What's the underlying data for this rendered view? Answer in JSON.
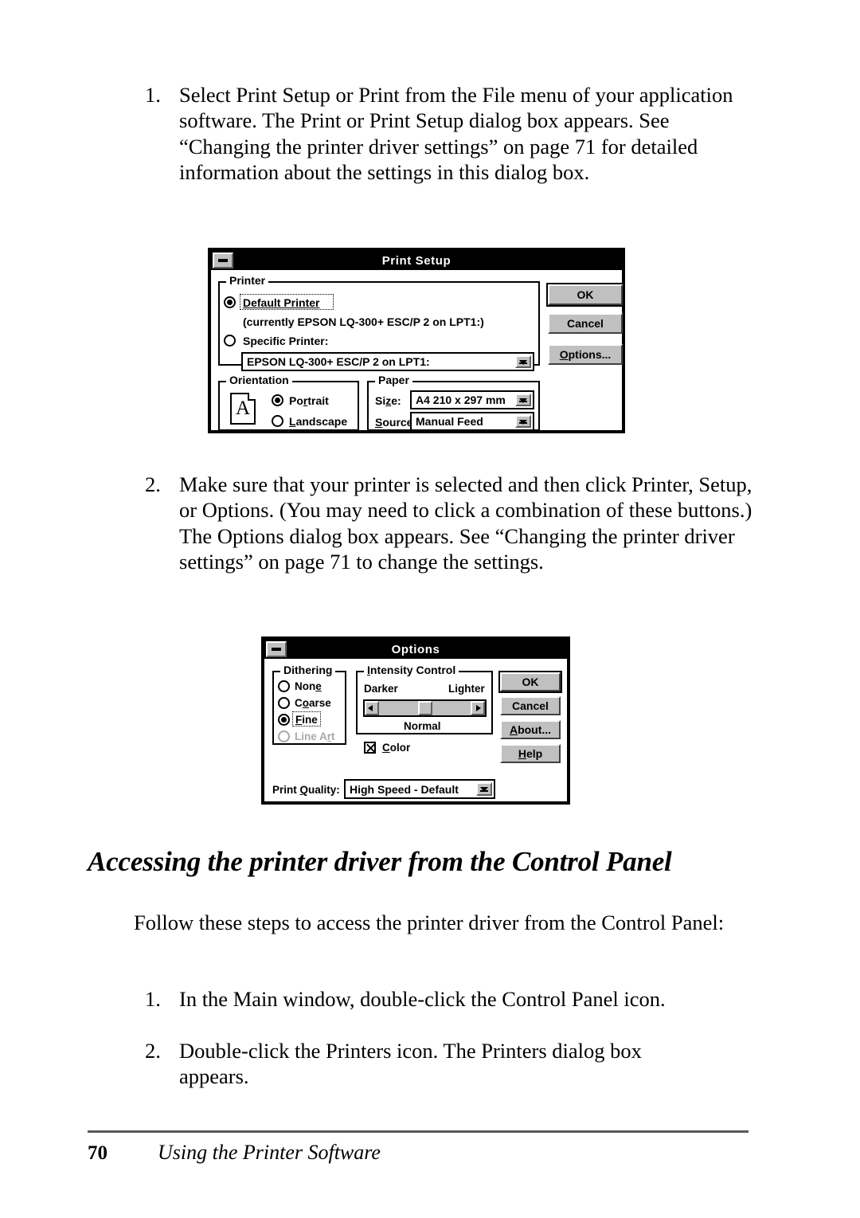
{
  "page": {
    "number": "70",
    "running_title": "Using the Printer Software"
  },
  "steps_top": [
    {
      "marker": "1.",
      "text": "Select Print Setup or Print from the File menu of your application software. The Print or Print Setup dialog box appears. See “Changing the printer driver settings” on page 71 for detailed information about the settings in this dialog box."
    },
    {
      "marker": "2.",
      "text": "Make sure that your printer is selected and then click Printer, Setup, or Options. (You may need to click a combination of these buttons.) The Options dialog box appears. See “Changing the printer driver settings” on page 71 to change the settings."
    }
  ],
  "print_setup_dialog": {
    "title": "Print Setup",
    "minimize_label": "—",
    "printer_group": {
      "label": "Printer",
      "default_printer_option": "Default Printer",
      "default_printer_current": "(currently EPSON LQ-300+ ESC/P 2 on LPT1:)",
      "specific_printer_option": "Specific Printer:",
      "specific_printer_value": "EPSON LQ-300+ ESC/P 2 on LPT1:"
    },
    "orientation_group": {
      "label": "Orientation",
      "icon_letter": "A",
      "portrait": "Portrait",
      "landscape": "Landscape"
    },
    "paper_group": {
      "label": "Paper",
      "size_label": "Size:",
      "size_value": "A4 210 x 297 mm",
      "source_label": "Source:",
      "source_value": "Manual Feed"
    },
    "buttons": {
      "ok": "OK",
      "cancel": "Cancel",
      "options": "Options..."
    }
  },
  "options_dialog": {
    "title": "Options",
    "minimize_label": "—",
    "dithering_group": {
      "label": "Dithering",
      "options": [
        "None",
        "Coarse",
        "Fine",
        "Line Art"
      ]
    },
    "intensity_group": {
      "label": "Intensity Control",
      "darker_label": "Darker",
      "lighter_label": "Lighter",
      "current_value": "Normal"
    },
    "color_checkbox": "Color",
    "print_quality_label": "Print Quality:",
    "print_quality_value": "High Speed - Default",
    "buttons": {
      "ok": "OK",
      "cancel": "Cancel",
      "about": "About...",
      "help": "Help"
    }
  },
  "section": {
    "heading": "Accessing the printer driver from the Control Panel",
    "intro": "Follow these steps to access the printer driver from the Control Panel:",
    "steps": [
      {
        "marker": "1.",
        "text": "In the Main window, double-click the Control Panel icon."
      },
      {
        "marker": "2.",
        "text": "Double-click the Printers icon. The Printers dialog box appears."
      }
    ]
  },
  "colors": {
    "dialog_face": "#c0c0c0",
    "titlebar": "#000000",
    "rule": "#595959",
    "disabled_text": "#a8a8a8"
  }
}
